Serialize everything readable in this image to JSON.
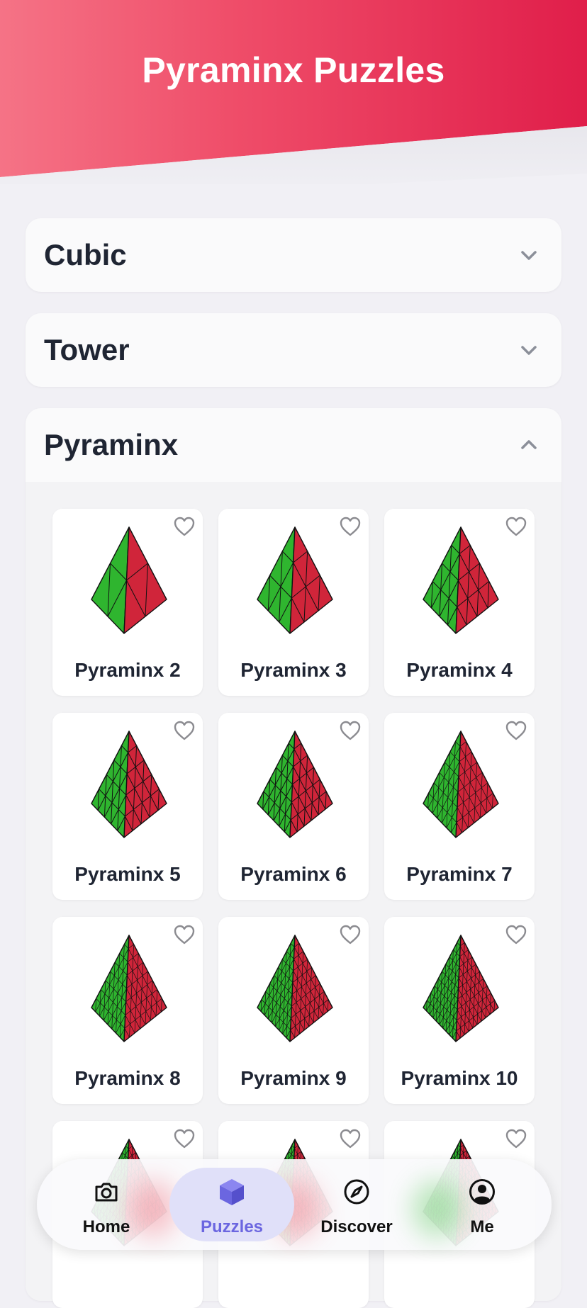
{
  "header": {
    "title": "Pyraminx Puzzles"
  },
  "sections": [
    {
      "title": "Cubic",
      "expanded": false
    },
    {
      "title": "Tower",
      "expanded": false
    },
    {
      "title": "Pyraminx",
      "expanded": true
    }
  ],
  "puzzles": [
    {
      "name": "Pyraminx 2",
      "order": 2
    },
    {
      "name": "Pyraminx 3",
      "order": 3
    },
    {
      "name": "Pyraminx 4",
      "order": 4
    },
    {
      "name": "Pyraminx 5",
      "order": 5
    },
    {
      "name": "Pyraminx 6",
      "order": 6
    },
    {
      "name": "Pyraminx 7",
      "order": 7
    },
    {
      "name": "Pyraminx 8",
      "order": 8
    },
    {
      "name": "Pyraminx 9",
      "order": 9
    },
    {
      "name": "Pyraminx 10",
      "order": 10
    }
  ],
  "nav": {
    "items": [
      {
        "label": "Home",
        "icon": "camera-icon"
      },
      {
        "label": "Puzzles",
        "icon": "cube-icon",
        "active": true
      },
      {
        "label": "Discover",
        "icon": "compass-icon"
      },
      {
        "label": "Me",
        "icon": "user-circle-icon"
      }
    ]
  },
  "colors": {
    "header_start": "#f57386",
    "header_end": "#e01e4a",
    "face_green": "#2fb52f",
    "face_red": "#d0253a",
    "active_nav": "#6b66e0"
  }
}
